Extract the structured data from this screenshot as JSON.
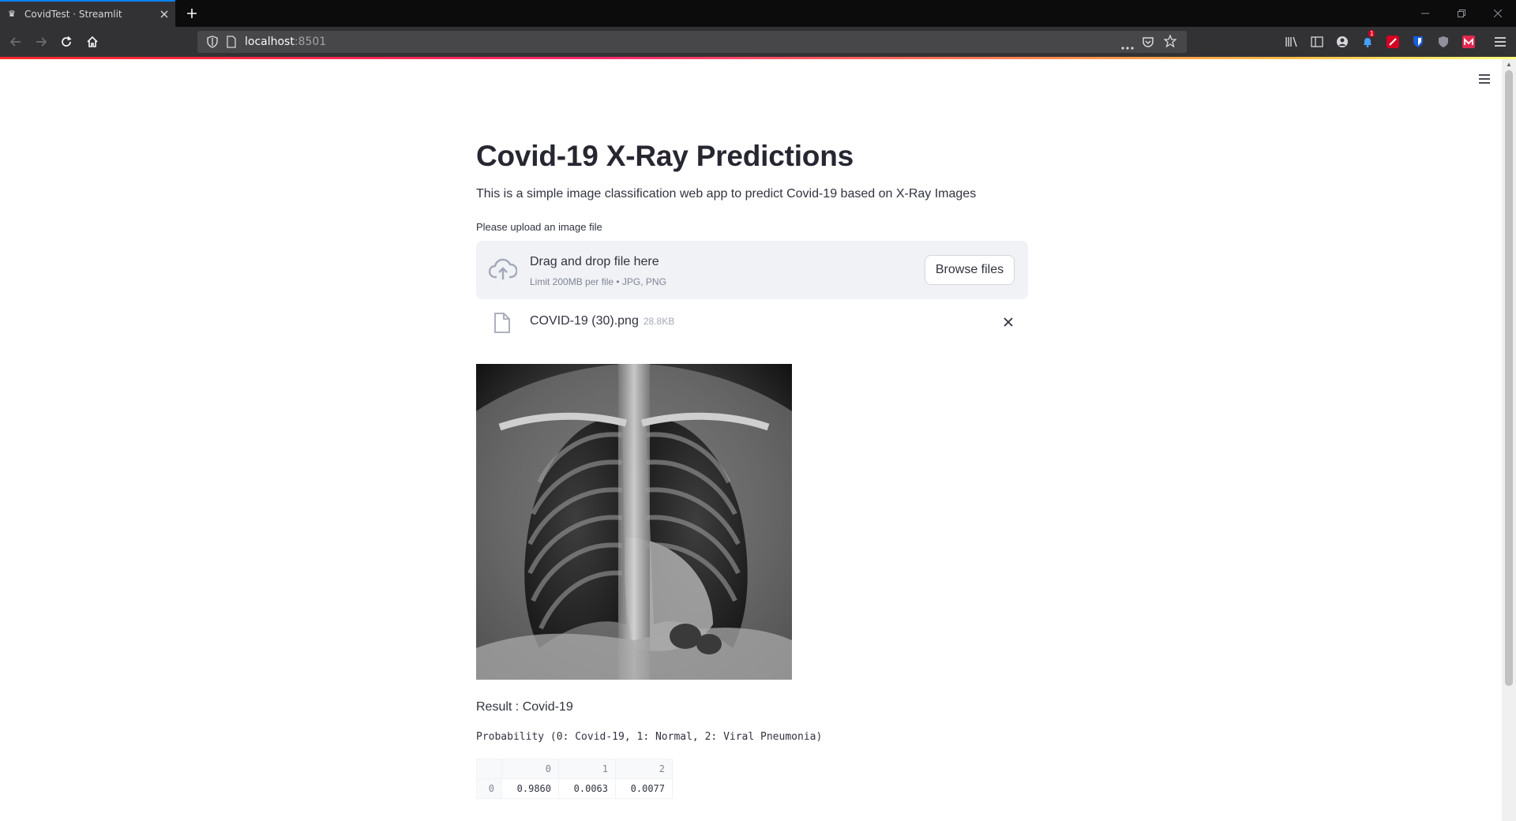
{
  "browser": {
    "tab_title": "CovidTest · Streamlit",
    "url_host": "localhost",
    "url_port": ":8501",
    "toolbar_badge": "1"
  },
  "app": {
    "title": "Covid-19 X-Ray Predictions",
    "subtitle": "This is a simple image classification web app to predict Covid-19 based on X-Ray Images",
    "upload_label": "Please upload an image file",
    "dropzone": {
      "title": "Drag and drop file here",
      "limit": "Limit 200MB per file • JPG, PNG",
      "browse_label": "Browse files"
    },
    "uploaded_file": {
      "name": "COVID-19 (30).png",
      "size": "28.8KB"
    },
    "result_text": "Result : Covid-19",
    "probability_caption": "Probability (0: Covid-19, 1: Normal, 2: Viral Pneumonia)",
    "probability_table": {
      "columns": [
        "0",
        "1",
        "2"
      ],
      "rows": [
        {
          "index": "0",
          "values": [
            "0.9860",
            "0.0063",
            "0.0077"
          ]
        }
      ]
    }
  },
  "icons": {
    "favicon": "streamlit-crown-icon",
    "upload": "cloud-upload-icon",
    "file": "file-icon",
    "remove": "close-icon"
  },
  "colors": {
    "accent_line": "#ff2b2b",
    "text_primary": "#31333f",
    "dropzone_bg": "#f0f2f6"
  }
}
